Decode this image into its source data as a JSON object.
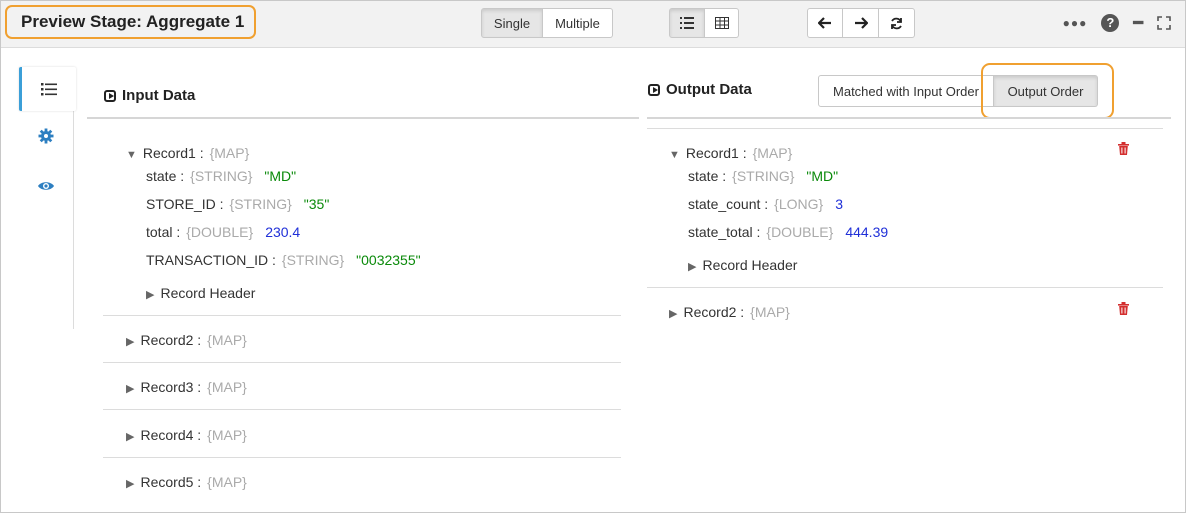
{
  "header": {
    "title": "Preview Stage: Aggregate 1",
    "mode_buttons": [
      "Single",
      "Multiple"
    ],
    "view_buttons": [
      "list-view-icon",
      "table-view-icon"
    ],
    "nav_buttons": [
      "arrow-left-icon",
      "arrow-right-icon",
      "refresh-icon"
    ],
    "right_icons": [
      "more-icon",
      "help-icon",
      "minimize-icon",
      "expand-icon"
    ],
    "help_glyph": "?"
  },
  "sidenav": {
    "items": [
      "list-icon",
      "gear-icon",
      "eye-icon"
    ]
  },
  "input": {
    "title": "Input Data",
    "record1": {
      "label": "Record1 :",
      "type": "{MAP}",
      "fields": [
        {
          "name": "state :",
          "type": "{STRING}",
          "value": "\"MD\"",
          "kind": "str"
        },
        {
          "name": "STORE_ID :",
          "type": "{STRING}",
          "value": "\"35\"",
          "kind": "str"
        },
        {
          "name": "total :",
          "type": "{DOUBLE}",
          "value": "230.4",
          "kind": "num"
        },
        {
          "name": "TRANSACTION_ID :",
          "type": "{STRING}",
          "value": "\"0032355\"",
          "kind": "str"
        }
      ],
      "header_label": "Record Header"
    },
    "collapsed": [
      {
        "label": "Record2 :",
        "type": "{MAP}"
      },
      {
        "label": "Record3 :",
        "type": "{MAP}"
      },
      {
        "label": "Record4 :",
        "type": "{MAP}"
      },
      {
        "label": "Record5 :",
        "type": "{MAP}"
      }
    ]
  },
  "output": {
    "title": "Output Data",
    "order_buttons": [
      "Matched with Input Order",
      "Output Order"
    ],
    "record1": {
      "label": "Record1 :",
      "type": "{MAP}",
      "fields": [
        {
          "name": "state :",
          "type": "{STRING}",
          "value": "\"MD\"",
          "kind": "str"
        },
        {
          "name": "state_count :",
          "type": "{LONG}",
          "value": "3",
          "kind": "num"
        },
        {
          "name": "state_total :",
          "type": "{DOUBLE}",
          "value": "444.39",
          "kind": "num"
        }
      ],
      "header_label": "Record Header"
    },
    "record2": {
      "label": "Record2 :",
      "type": "{MAP}"
    }
  },
  "colors": {
    "accent_highlight": "#f0a030",
    "string_value": "#0a8a0a",
    "number_value": "#1f2fd8",
    "delete": "#d32f2f",
    "nav_active": "#3b9fd8"
  }
}
